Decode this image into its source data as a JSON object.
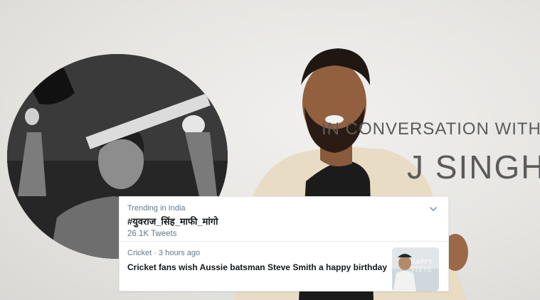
{
  "stage": {
    "line1": "IN CONVERSATION WITH",
    "line2": "J SINGH"
  },
  "trend": {
    "context": "Trending in India",
    "name": "#युवराज_सिंह_माफी_मांगो",
    "count": "26.1K Tweets",
    "chevron_icon": "chevron-down-icon"
  },
  "story": {
    "category": "Cricket",
    "separator": "·",
    "time": "3 hours ago",
    "title": "Cricket fans wish Aussie batsman Steve Smith a happy birthday",
    "emoji_icon": "cricket-bat-icon",
    "thumb_text_1": "HAPPY",
    "thumb_text_2": "STEVE"
  },
  "colors": {
    "secondary_text": "#657786",
    "primary_text": "#14171a",
    "card_background": "#ffffff",
    "divider": "#e6ecf0"
  }
}
